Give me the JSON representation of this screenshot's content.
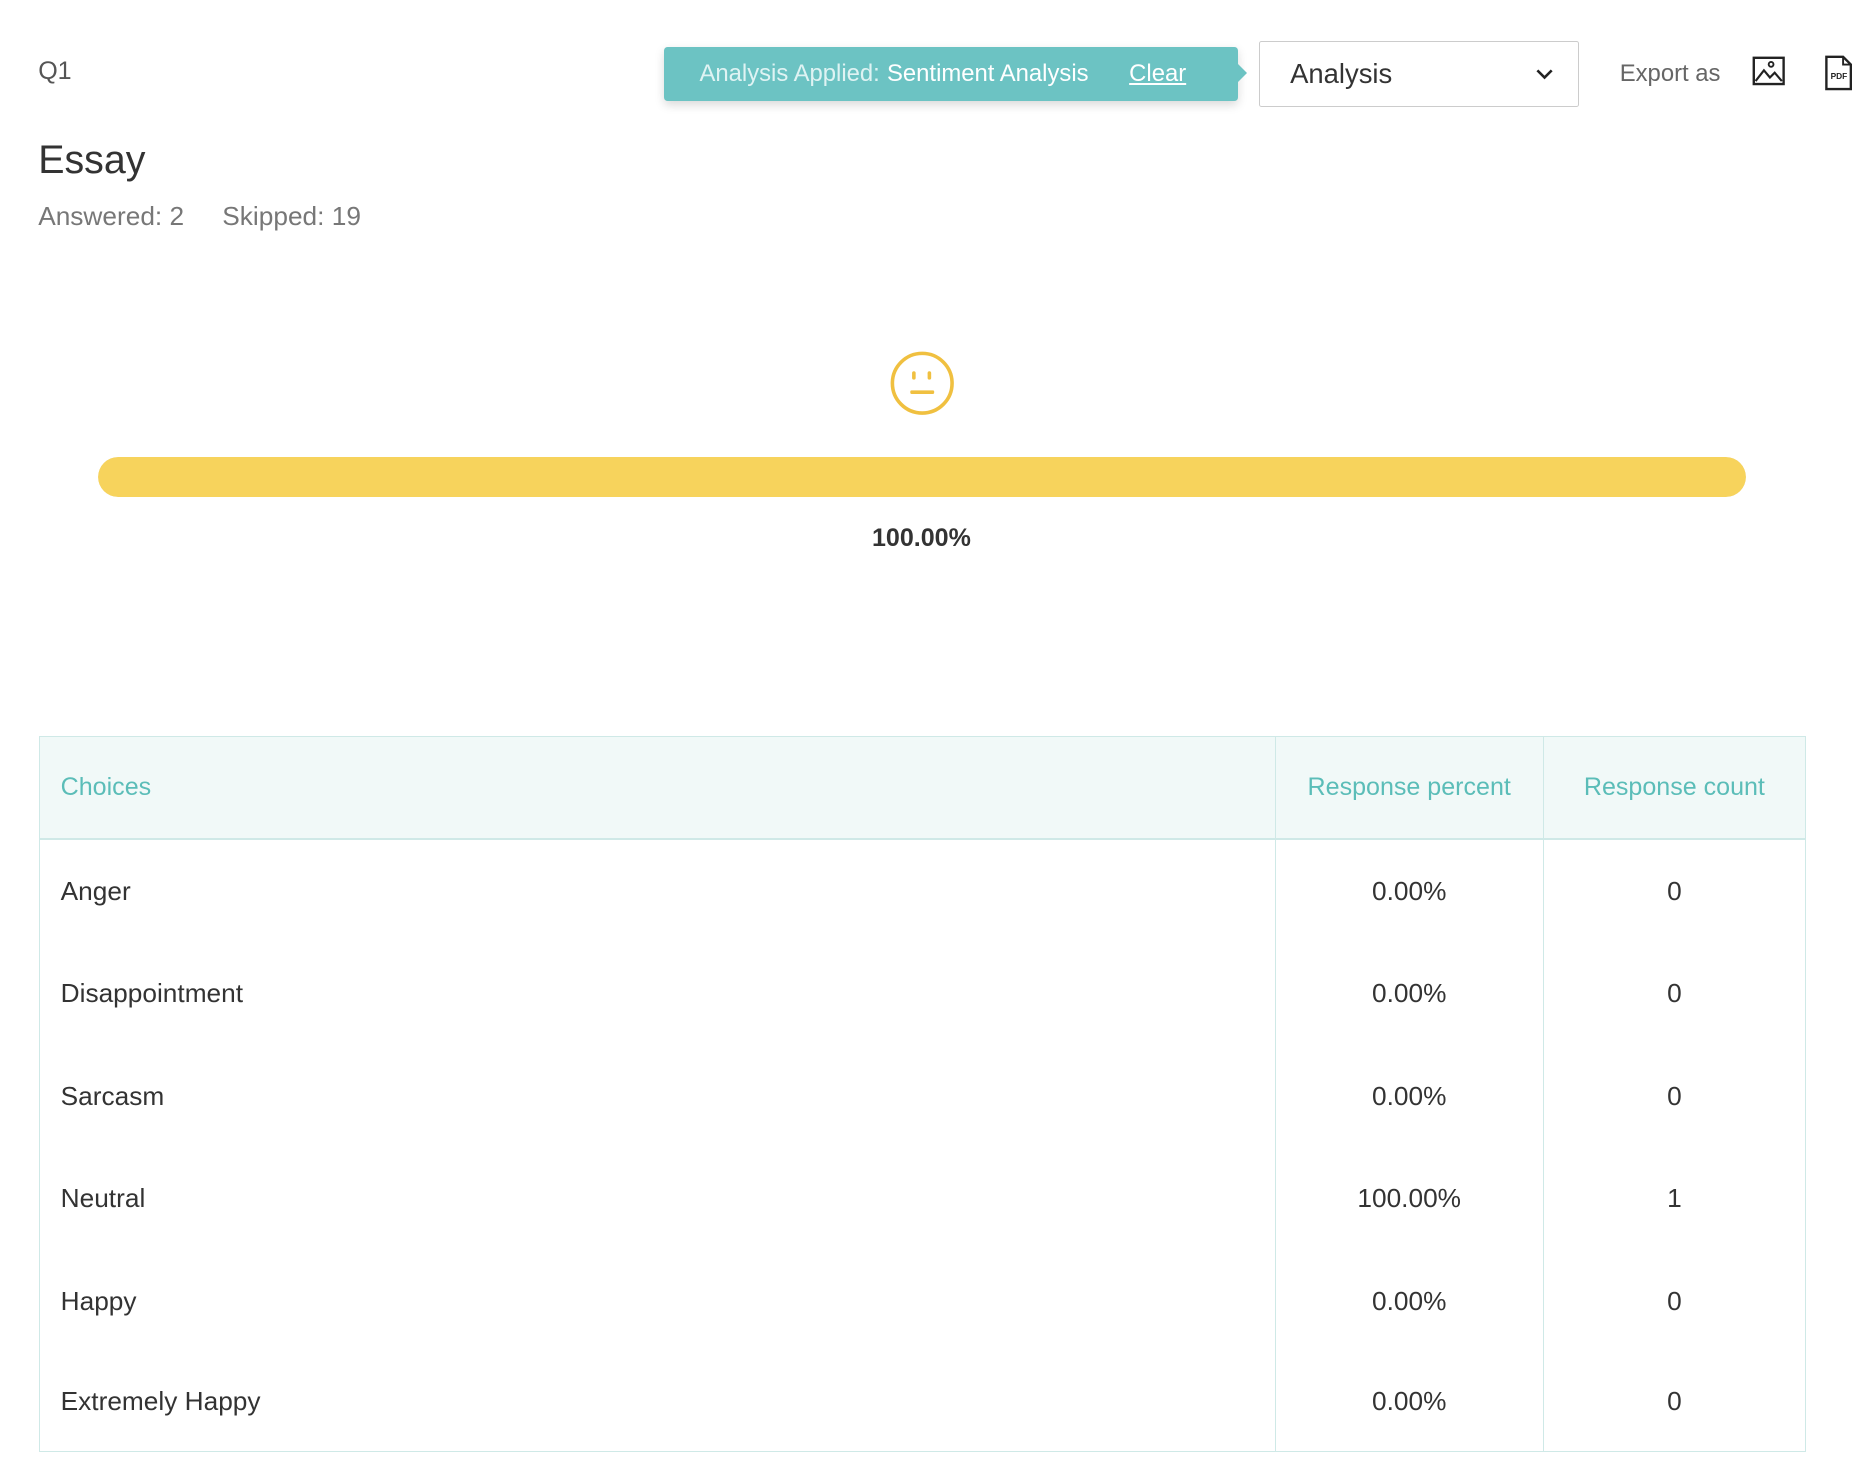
{
  "question": {
    "number": "Q1",
    "type": "Essay",
    "answered_label": "Answered: 2",
    "skipped_label": "Skipped: 19"
  },
  "banner": {
    "label": "Analysis Applied:",
    "value": "Sentiment Analysis",
    "clear": "Clear"
  },
  "dropdown": {
    "selected": "Analysis"
  },
  "export": {
    "label": "Export as",
    "image_icon": "image-icon",
    "pdf_icon": "pdf-icon",
    "pdf_text": "PDF"
  },
  "sentiment": {
    "icon": "neutral-face-icon",
    "percent": 100,
    "percent_label": "100.00%",
    "color": "#f7d35c"
  },
  "table": {
    "headers": [
      "Choices",
      "Response percent",
      "Response count"
    ],
    "rows": [
      {
        "choice": "Anger",
        "percent": "0.00%",
        "count": "0"
      },
      {
        "choice": "Disappointment",
        "percent": "0.00%",
        "count": "0"
      },
      {
        "choice": "Sarcasm",
        "percent": "0.00%",
        "count": "0"
      },
      {
        "choice": "Neutral",
        "percent": "100.00%",
        "count": "1"
      },
      {
        "choice": "Happy",
        "percent": "0.00%",
        "count": "0"
      },
      {
        "choice": "Extremely Happy",
        "percent": "0.00%",
        "count": "0"
      }
    ]
  }
}
